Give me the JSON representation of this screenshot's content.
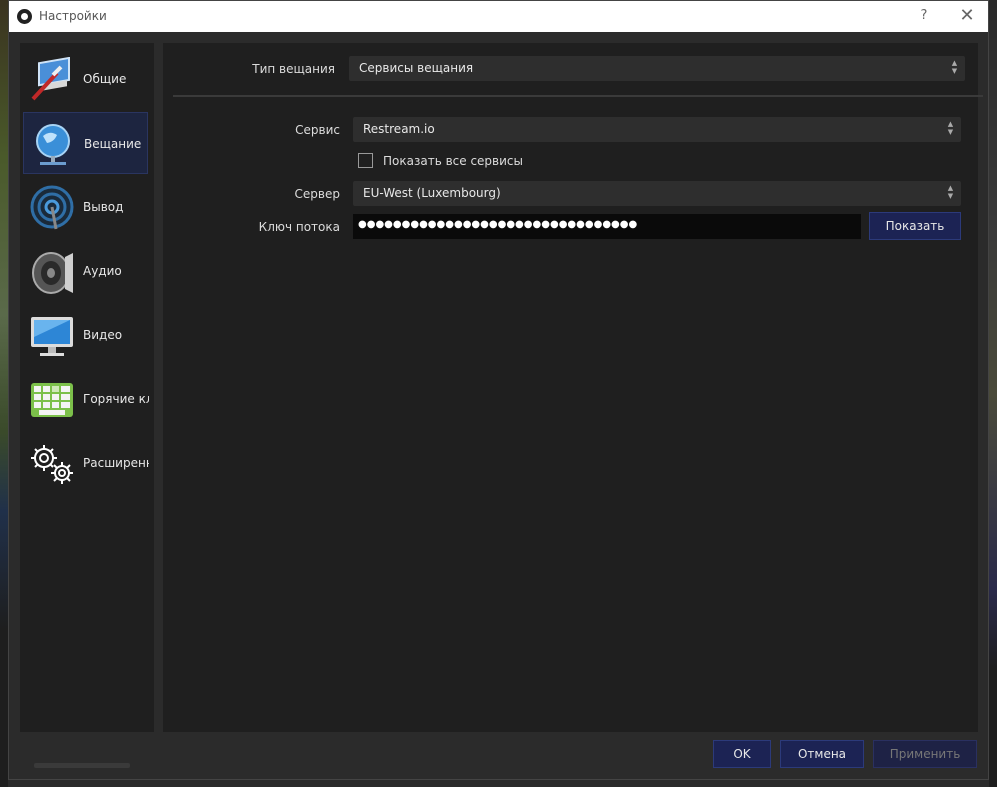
{
  "window": {
    "title": "Настройки",
    "help_glyph": "?",
    "close_glyph": "✕"
  },
  "sidebar": {
    "items": [
      {
        "label": "Общие",
        "icon": "general-settings-icon"
      },
      {
        "label": "Вещание",
        "icon": "stream-globe-icon",
        "active": true
      },
      {
        "label": "Вывод",
        "icon": "output-antenna-icon"
      },
      {
        "label": "Аудио",
        "icon": "audio-speaker-icon"
      },
      {
        "label": "Видео",
        "icon": "video-monitor-icon"
      },
      {
        "label": "Горячие клавиши",
        "icon": "hotkeys-keyboard-icon"
      },
      {
        "label": "Расширенные",
        "icon": "advanced-gears-icon"
      }
    ]
  },
  "stream": {
    "stream_type_label": "Тип вещания",
    "stream_type_value": "Сервисы вещания",
    "service_label": "Сервис",
    "service_value": "Restream.io",
    "show_all_label": "Показать все сервисы",
    "show_all_checked": false,
    "server_label": "Сервер",
    "server_value": "EU-West (Luxembourg)",
    "key_label": "Ключ потока",
    "key_value": "●●●●●●●●●●●●●●●●●●●●●●●●●●●●●●●●",
    "show_button": "Показать"
  },
  "footer": {
    "ok": "OK",
    "cancel": "Отмена",
    "apply": "Применить"
  },
  "colors": {
    "accent": "#1c2354",
    "panel": "#1f1f1f",
    "background": "#2b2b2b",
    "active_item": "#1d2540"
  }
}
